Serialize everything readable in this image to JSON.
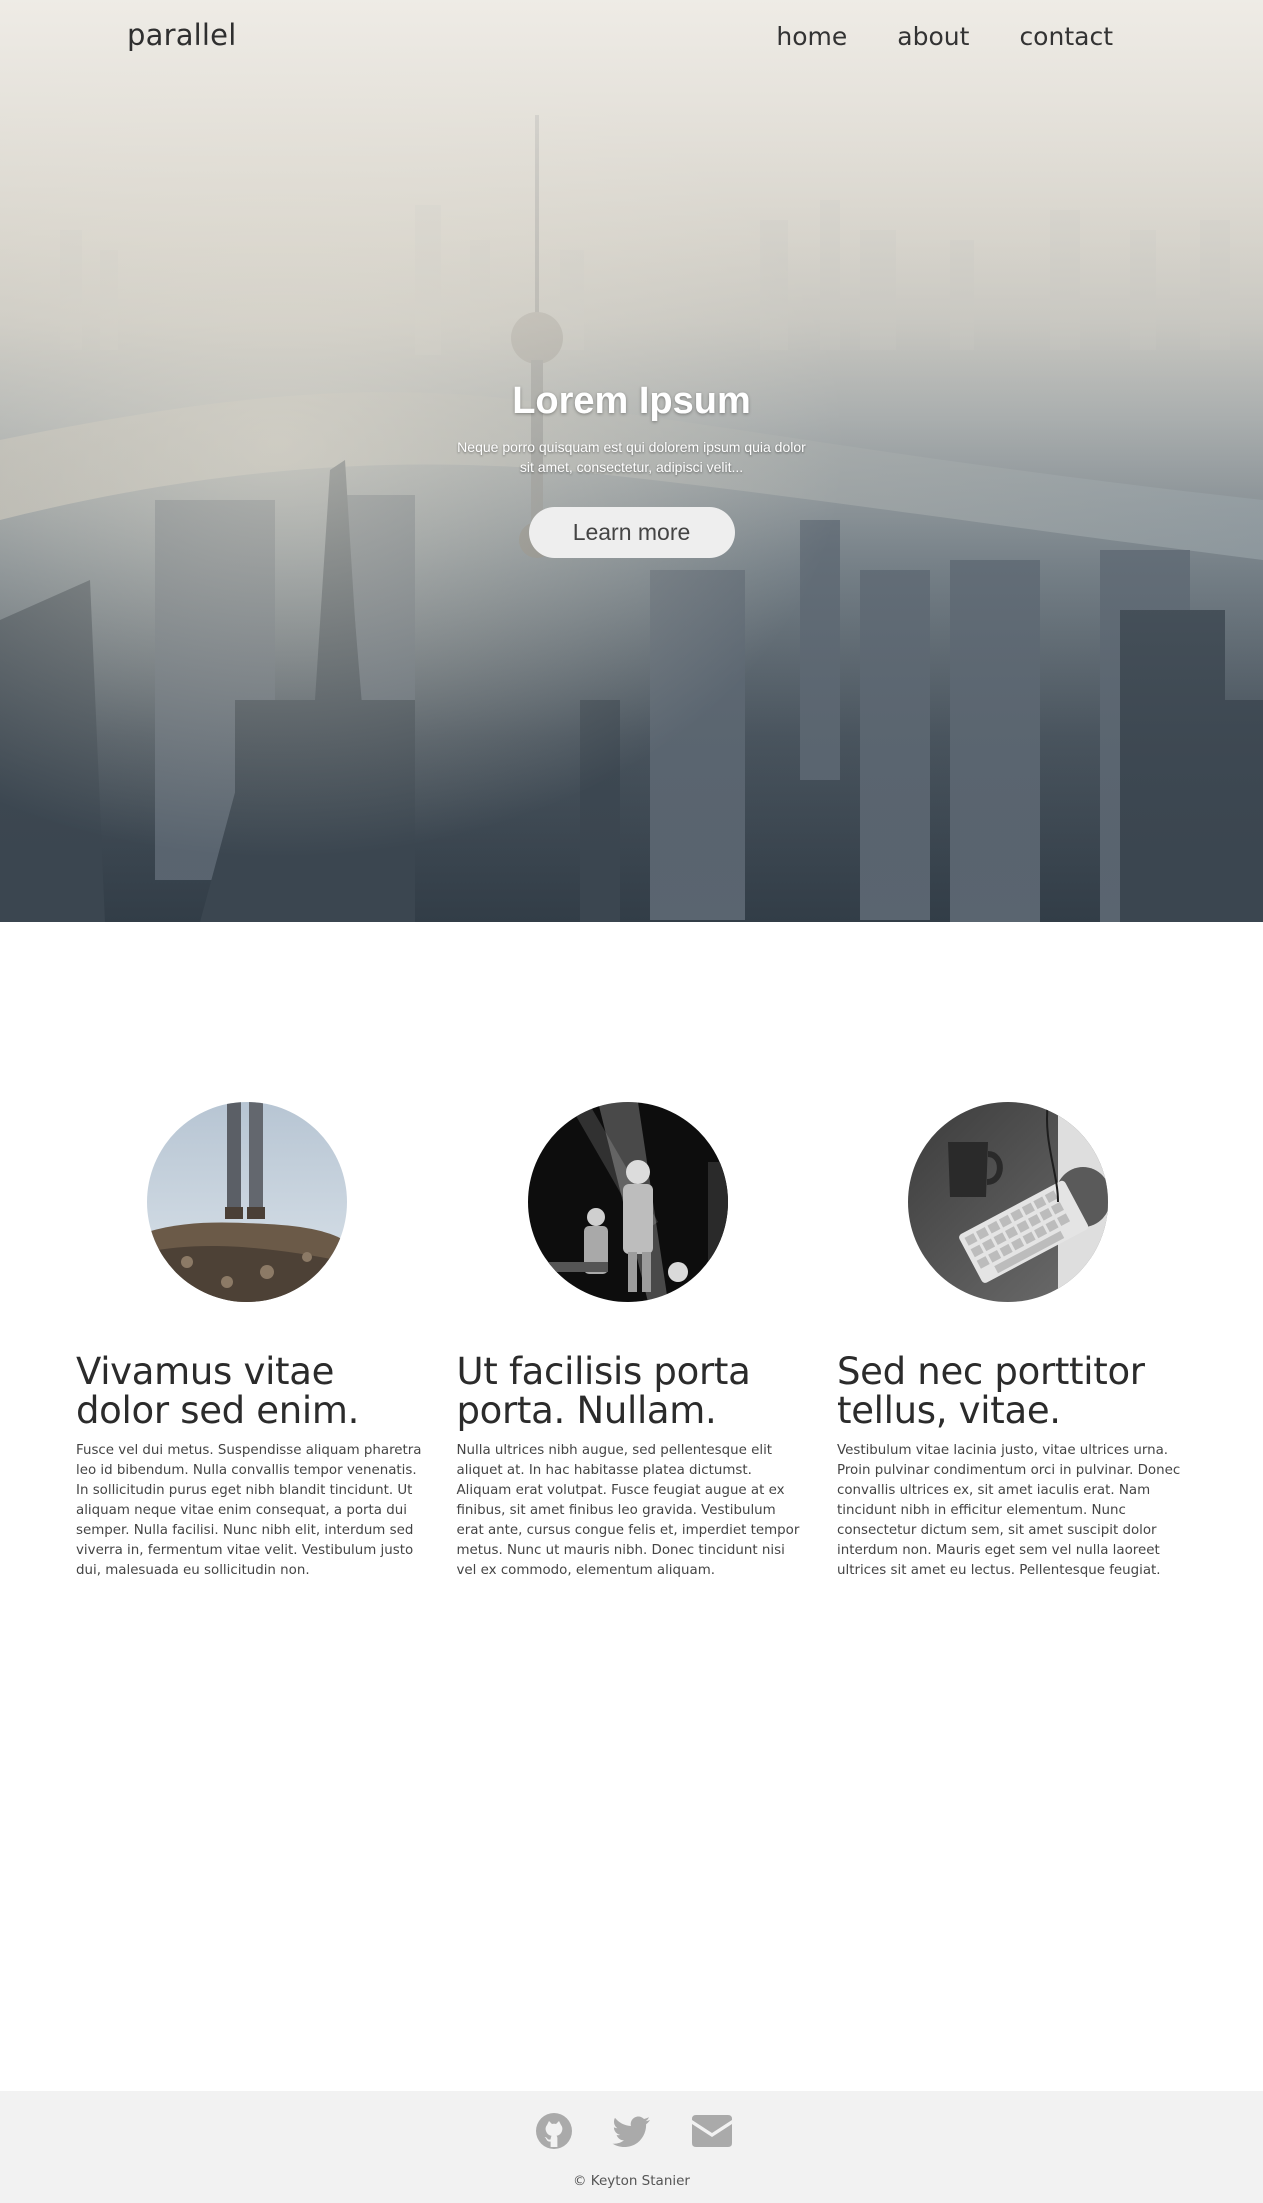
{
  "header": {
    "brand": "parallel",
    "nav": [
      "home",
      "about",
      "contact"
    ]
  },
  "hero": {
    "title": "Lorem Ipsum",
    "text": "Neque porro quisquam est qui dolorem ipsum quia dolor sit amet, consectetur, adipisci velit...",
    "button": "Learn more"
  },
  "features": [
    {
      "image": "legs-on-rocks-photo",
      "title": "Vivamus vitae dolor sed enim.",
      "text": "Fusce vel dui metus. Suspendisse aliquam pharetra leo id bibendum. Nulla convallis tempor venenatis. In sollicitudin purus eget nibh blandit tincidunt. Ut aliquam neque vitae enim consequat, a porta dui semper. Nulla facilisi. Nunc nibh elit, interdum sed viverra in, fermentum vitae velit. Vestibulum justo dui, malesuada eu sollicitudin non."
    },
    {
      "image": "concert-band-photo",
      "title": "Ut facilisis porta porta. Nullam.",
      "text": "Nulla ultrices nibh augue, sed pellentesque elit aliquet at. In hac habitasse platea dictumst. Aliquam erat volutpat. Fusce feugiat augue at ex finibus, sit amet finibus leo gravida. Vestibulum erat ante, cursus congue felis et, imperdiet tempor metus. Nunc ut mauris nibh. Donec tincidunt nisi vel ex commodo, elementum aliquam."
    },
    {
      "image": "desk-keyboard-mug-photo",
      "title": "Sed nec porttitor tellus, vitae.",
      "text": "Vestibulum vitae lacinia justo, vitae ultrices urna. Proin pulvinar condimentum orci in pulvinar. Donec convallis ultrices ex, sit amet iaculis erat. Nam tincidunt nibh in efficitur elementum. Nunc consectetur dictum sem, sit amet suscipit dolor interdum non. Mauris eget sem vel nulla laoreet ultrices sit amet eu lectus. Pellentesque feugiat."
    }
  ],
  "footer": {
    "social": [
      "github-icon",
      "twitter-icon",
      "envelope-icon"
    ],
    "copyright": "© Keyton Stanier"
  }
}
